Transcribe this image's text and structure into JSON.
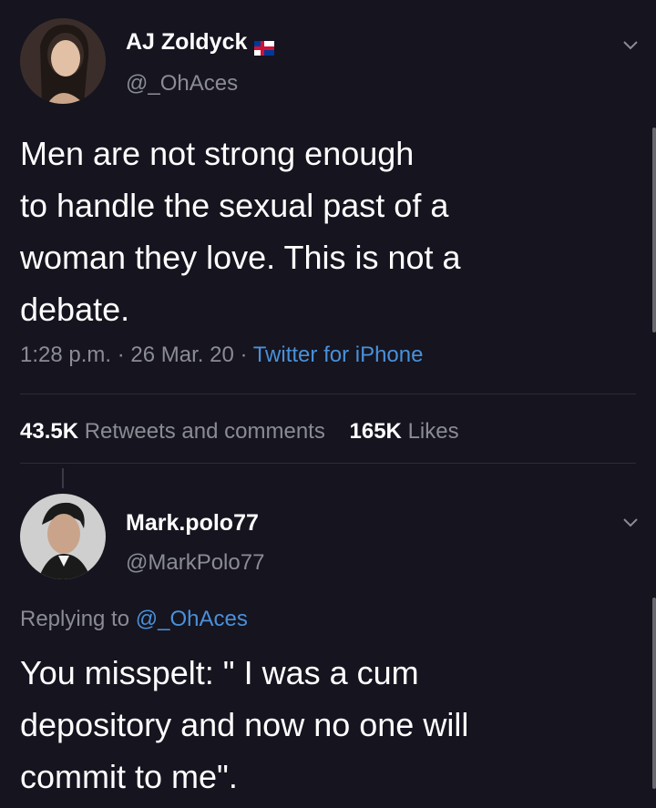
{
  "tweet": {
    "author_name": "AJ Zoldyck",
    "author_handle": "@_OhAces",
    "text": "Men are not strong enough\nto handle the sexual past of a\nwoman they love. This is not a\ndebate.",
    "time": "1:28 p.m.",
    "date": "26 Mar. 20",
    "source": "Twitter for iPhone",
    "separator": "·",
    "retweets_count": "43.5K",
    "retweets_label": "Retweets and comments",
    "likes_count": "165K",
    "likes_label": "Likes"
  },
  "reply": {
    "author_name": "Mark.polo77",
    "author_handle": "@MarkPolo77",
    "replying_prefix": "Replying to",
    "replying_handle": "@_OhAces",
    "text": "You misspelt: \" I was a cum\ndepository and now no one will\ncommit to me\"."
  },
  "colors": {
    "background": "#15141f",
    "link": "#4a90d9",
    "muted": "#8a8c93"
  },
  "icons": [
    "chevron-down-icon",
    "flag-icon",
    "avatar"
  ]
}
